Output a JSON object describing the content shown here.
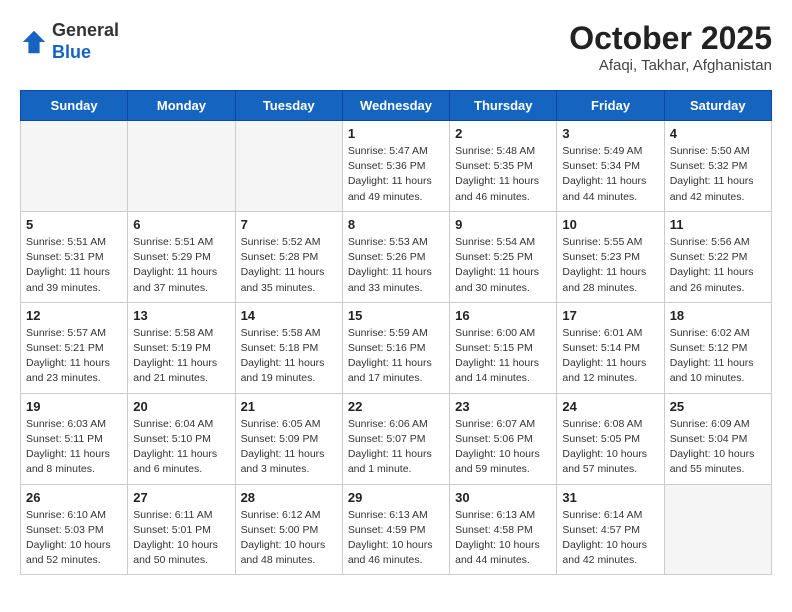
{
  "header": {
    "logo_line1": "General",
    "logo_line2": "Blue",
    "month_title": "October 2025",
    "location": "Afaqi, Takhar, Afghanistan"
  },
  "days_of_week": [
    "Sunday",
    "Monday",
    "Tuesday",
    "Wednesday",
    "Thursday",
    "Friday",
    "Saturday"
  ],
  "weeks": [
    [
      {
        "day": "",
        "info": ""
      },
      {
        "day": "",
        "info": ""
      },
      {
        "day": "",
        "info": ""
      },
      {
        "day": "1",
        "info": "Sunrise: 5:47 AM\nSunset: 5:36 PM\nDaylight: 11 hours\nand 49 minutes."
      },
      {
        "day": "2",
        "info": "Sunrise: 5:48 AM\nSunset: 5:35 PM\nDaylight: 11 hours\nand 46 minutes."
      },
      {
        "day": "3",
        "info": "Sunrise: 5:49 AM\nSunset: 5:34 PM\nDaylight: 11 hours\nand 44 minutes."
      },
      {
        "day": "4",
        "info": "Sunrise: 5:50 AM\nSunset: 5:32 PM\nDaylight: 11 hours\nand 42 minutes."
      }
    ],
    [
      {
        "day": "5",
        "info": "Sunrise: 5:51 AM\nSunset: 5:31 PM\nDaylight: 11 hours\nand 39 minutes."
      },
      {
        "day": "6",
        "info": "Sunrise: 5:51 AM\nSunset: 5:29 PM\nDaylight: 11 hours\nand 37 minutes."
      },
      {
        "day": "7",
        "info": "Sunrise: 5:52 AM\nSunset: 5:28 PM\nDaylight: 11 hours\nand 35 minutes."
      },
      {
        "day": "8",
        "info": "Sunrise: 5:53 AM\nSunset: 5:26 PM\nDaylight: 11 hours\nand 33 minutes."
      },
      {
        "day": "9",
        "info": "Sunrise: 5:54 AM\nSunset: 5:25 PM\nDaylight: 11 hours\nand 30 minutes."
      },
      {
        "day": "10",
        "info": "Sunrise: 5:55 AM\nSunset: 5:23 PM\nDaylight: 11 hours\nand 28 minutes."
      },
      {
        "day": "11",
        "info": "Sunrise: 5:56 AM\nSunset: 5:22 PM\nDaylight: 11 hours\nand 26 minutes."
      }
    ],
    [
      {
        "day": "12",
        "info": "Sunrise: 5:57 AM\nSunset: 5:21 PM\nDaylight: 11 hours\nand 23 minutes."
      },
      {
        "day": "13",
        "info": "Sunrise: 5:58 AM\nSunset: 5:19 PM\nDaylight: 11 hours\nand 21 minutes."
      },
      {
        "day": "14",
        "info": "Sunrise: 5:58 AM\nSunset: 5:18 PM\nDaylight: 11 hours\nand 19 minutes."
      },
      {
        "day": "15",
        "info": "Sunrise: 5:59 AM\nSunset: 5:16 PM\nDaylight: 11 hours\nand 17 minutes."
      },
      {
        "day": "16",
        "info": "Sunrise: 6:00 AM\nSunset: 5:15 PM\nDaylight: 11 hours\nand 14 minutes."
      },
      {
        "day": "17",
        "info": "Sunrise: 6:01 AM\nSunset: 5:14 PM\nDaylight: 11 hours\nand 12 minutes."
      },
      {
        "day": "18",
        "info": "Sunrise: 6:02 AM\nSunset: 5:12 PM\nDaylight: 11 hours\nand 10 minutes."
      }
    ],
    [
      {
        "day": "19",
        "info": "Sunrise: 6:03 AM\nSunset: 5:11 PM\nDaylight: 11 hours\nand 8 minutes."
      },
      {
        "day": "20",
        "info": "Sunrise: 6:04 AM\nSunset: 5:10 PM\nDaylight: 11 hours\nand 6 minutes."
      },
      {
        "day": "21",
        "info": "Sunrise: 6:05 AM\nSunset: 5:09 PM\nDaylight: 11 hours\nand 3 minutes."
      },
      {
        "day": "22",
        "info": "Sunrise: 6:06 AM\nSunset: 5:07 PM\nDaylight: 11 hours\nand 1 minute."
      },
      {
        "day": "23",
        "info": "Sunrise: 6:07 AM\nSunset: 5:06 PM\nDaylight: 10 hours\nand 59 minutes."
      },
      {
        "day": "24",
        "info": "Sunrise: 6:08 AM\nSunset: 5:05 PM\nDaylight: 10 hours\nand 57 minutes."
      },
      {
        "day": "25",
        "info": "Sunrise: 6:09 AM\nSunset: 5:04 PM\nDaylight: 10 hours\nand 55 minutes."
      }
    ],
    [
      {
        "day": "26",
        "info": "Sunrise: 6:10 AM\nSunset: 5:03 PM\nDaylight: 10 hours\nand 52 minutes."
      },
      {
        "day": "27",
        "info": "Sunrise: 6:11 AM\nSunset: 5:01 PM\nDaylight: 10 hours\nand 50 minutes."
      },
      {
        "day": "28",
        "info": "Sunrise: 6:12 AM\nSunset: 5:00 PM\nDaylight: 10 hours\nand 48 minutes."
      },
      {
        "day": "29",
        "info": "Sunrise: 6:13 AM\nSunset: 4:59 PM\nDaylight: 10 hours\nand 46 minutes."
      },
      {
        "day": "30",
        "info": "Sunrise: 6:13 AM\nSunset: 4:58 PM\nDaylight: 10 hours\nand 44 minutes."
      },
      {
        "day": "31",
        "info": "Sunrise: 6:14 AM\nSunset: 4:57 PM\nDaylight: 10 hours\nand 42 minutes."
      },
      {
        "day": "",
        "info": ""
      }
    ]
  ]
}
